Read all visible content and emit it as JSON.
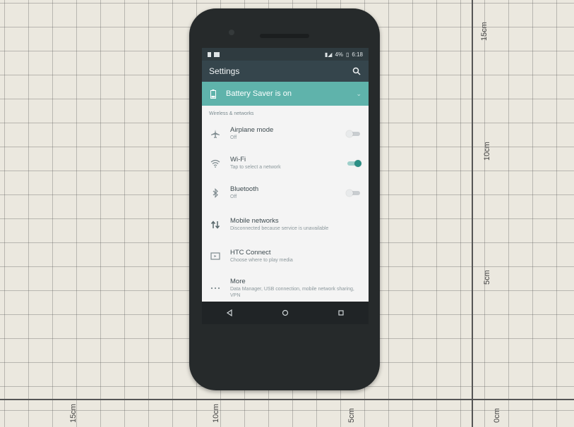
{
  "status_bar": {
    "battery_percent": "4%",
    "time": "6:18"
  },
  "header": {
    "title": "Settings",
    "search_icon": "search-icon"
  },
  "banner": {
    "text": "Battery Saver is on",
    "icon": "battery-icon"
  },
  "section": {
    "title": "Wireless & networks"
  },
  "items": [
    {
      "title": "Airplane mode",
      "subtitle": "Off",
      "icon": "airplane-icon",
      "toggle": "off"
    },
    {
      "title": "Wi-Fi",
      "subtitle": "Tap to select a network",
      "icon": "wifi-icon",
      "toggle": "on"
    },
    {
      "title": "Bluetooth",
      "subtitle": "Off",
      "icon": "bluetooth-icon",
      "toggle": "off"
    },
    {
      "title": "Mobile networks",
      "subtitle": "Disconnected because service is unavailable",
      "icon": "mobile-data-icon"
    },
    {
      "title": "HTC Connect",
      "subtitle": "Choose where to play media",
      "icon": "cast-icon"
    },
    {
      "title": "More",
      "subtitle": "Data Manager, USB connection, mobile network sharing, VPN",
      "icon": "more-icon"
    }
  ],
  "navbar": {
    "buttons": [
      "back-icon",
      "home-icon",
      "recents-icon"
    ]
  },
  "ruler": {
    "labels_right": [
      "15cm",
      "10cm",
      "5cm"
    ],
    "labels_bottom": [
      "15cm",
      "10cm",
      "5cm",
      "0cm"
    ]
  },
  "colors": {
    "banner": "#5fb3ab",
    "appbar": "#35454c",
    "accent": "#2b8f85"
  }
}
